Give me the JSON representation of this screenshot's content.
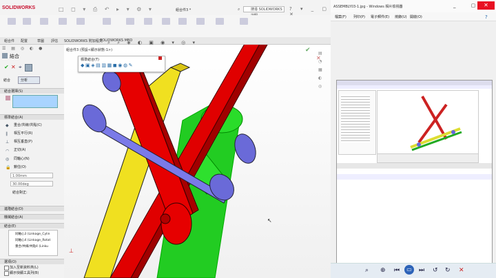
{
  "solidworks": {
    "logo": "SOLIDWORKS",
    "document_title": "組合件3 *",
    "search_placeholder": "搜尋 SOLIDWORKS 說明",
    "tabs": [
      "組合件",
      "配置",
      "草圖",
      "評估",
      "SOLIDWORKS 附加程式",
      "SOLIDWORKS MBD"
    ],
    "breadcrumb": "組合件3 (預設<顯示狀態-1>)",
    "property_manager": {
      "title": "結合",
      "tab_mates": "結合",
      "tab_analysis": "分析",
      "section_selections": "結合選擇(S)",
      "section_standard": "標準結合(A)",
      "standard_mates": [
        "重合/共線/共點(C)",
        "相互平行(R)",
        "相互垂直(P)",
        "正切(A)",
        "同軸心(N)",
        "鎖住(O)"
      ],
      "distance": "1.00mm",
      "angle": "30.00deg",
      "mate_alignment": "結合對正:",
      "section_advanced": "進階結合(D)",
      "section_mechanical": "機械結合(A)",
      "section_mates": "結合(E)",
      "mates_list": [
        "同軸心3 (Linkage_Cylin",
        "同軸心4 (Linkage_Rotat",
        "重合/共線/共點4 (Linku"
      ],
      "section_options": "選項(O)",
      "option_1": "加入至新資料夾(L)",
      "option_2": "顯示快顯工具列(B)"
    },
    "hud_title": "標準結合(T)",
    "colors": {
      "red": "#e60000",
      "yellow": "#f0e020",
      "green": "#2ad42a",
      "blue": "#7070e0",
      "brand": "#c8102e"
    }
  },
  "photo_viewer": {
    "title": "ASSEMBLY03-1.jpg - Windows 相片檢視器",
    "menu": [
      "檔案(F)",
      "列印(P)",
      "電子郵件(E)",
      "燒錄(U)",
      "開啟(O)"
    ],
    "nav_icons": [
      "zoom-icon",
      "fit-icon",
      "previous-icon",
      "slideshow-icon",
      "next-icon",
      "rotate-ccw-icon",
      "rotate-cw-icon",
      "delete-icon"
    ]
  }
}
